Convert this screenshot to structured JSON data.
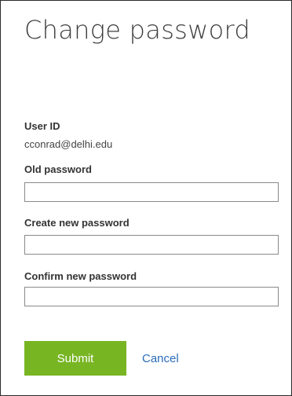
{
  "title": "Change password",
  "user": {
    "label": "User ID",
    "value": "cconrad@delhi.edu"
  },
  "fields": {
    "old_password": {
      "label": "Old password",
      "value": "",
      "placeholder": ""
    },
    "new_password": {
      "label": "Create new password",
      "value": "",
      "placeholder": ""
    },
    "confirm_password": {
      "label": "Confirm new password",
      "value": "",
      "placeholder": ""
    }
  },
  "actions": {
    "submit_label": "Submit",
    "cancel_label": "Cancel"
  },
  "colors": {
    "submit_bg": "#78b523",
    "link": "#2a6db8",
    "border": "#2b2b2b"
  }
}
